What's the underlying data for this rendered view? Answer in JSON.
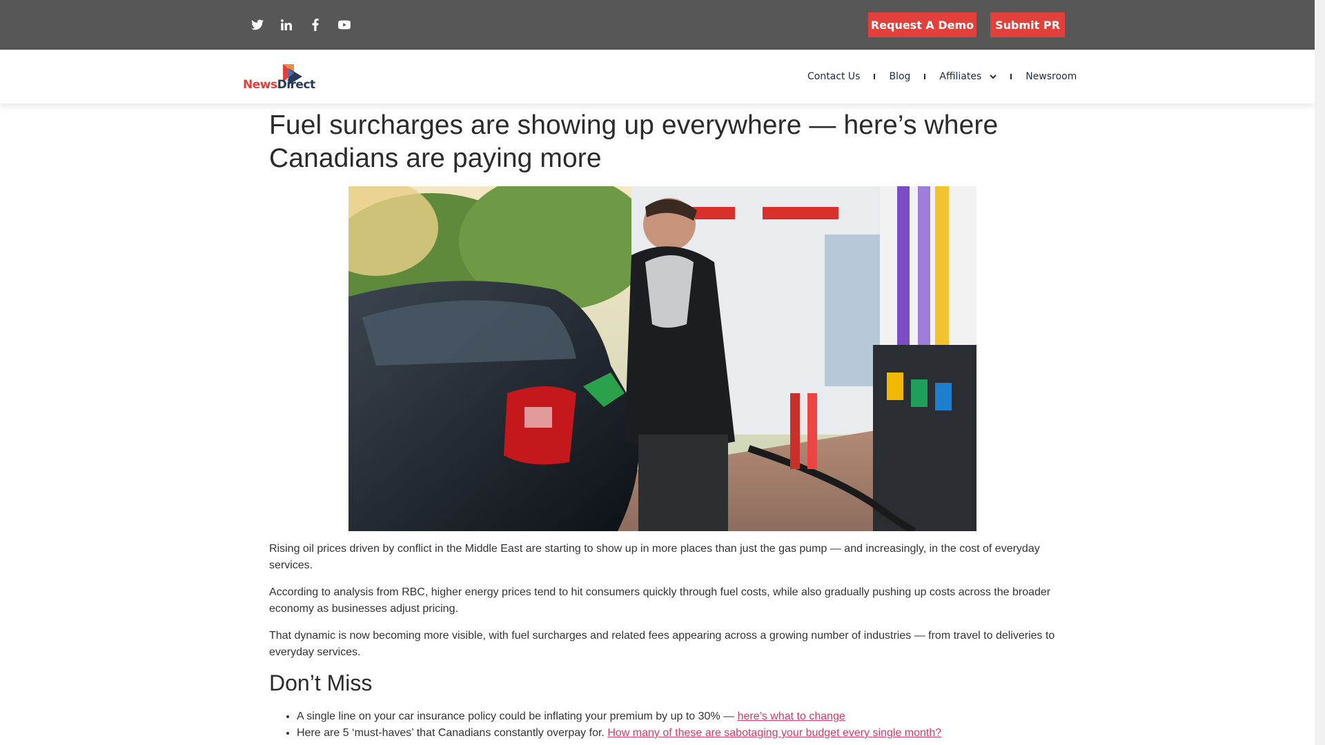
{
  "topbar": {
    "social": [
      "twitter-icon",
      "linkedin-icon",
      "facebook-icon",
      "youtube-icon"
    ],
    "request_demo": "Request A Demo",
    "submit_pr": "Submit PR"
  },
  "header": {
    "logo_news": "News",
    "logo_direct": "Direct",
    "nav": [
      {
        "label": "Contact Us"
      },
      {
        "label": "Blog"
      },
      {
        "label": "Affiliates"
      },
      {
        "label": "Newsroom"
      }
    ]
  },
  "article": {
    "headline": "Fuel surcharges are showing up everywhere — here’s where Canadians are paying more",
    "paragraphs": [
      "Rising oil prices driven by conflict in the Middle East are starting to show up in more places than just the gas pump — and increasingly, in the cost of everyday services.",
      "According to analysis from RBC, higher energy prices tend to hit consumers quickly through fuel costs, while also gradually pushing up costs across the broader economy as businesses adjust pricing.",
      "That dynamic is now becoming more visible, with fuel surcharges and related fees appearing across a growing number of industries — from travel to deliveries to everyday services."
    ],
    "subhead": "Don’t Miss",
    "list": [
      {
        "text": "A single line on your car insurance policy could be inflating your premium by up to 30% — ",
        "link": "here’s what to change"
      },
      {
        "text": "Here are 5 ‘must-haves’ that Canadians constantly overpay for. ",
        "link": "How many of these are sabotaging your budget every single month?"
      }
    ]
  },
  "colors": {
    "topbar": "#575757",
    "accent": "#e2403a",
    "link": "#d63a66",
    "nav_text": "#1f2a44"
  }
}
